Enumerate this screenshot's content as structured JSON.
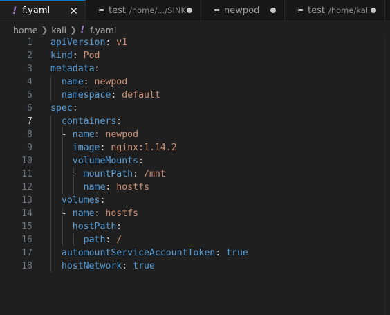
{
  "tabs": [
    {
      "label": "f.yaml",
      "icon": "yaml-exclamation-icon",
      "path": "",
      "active": true,
      "state": "close"
    },
    {
      "label": "test",
      "icon": "file-lines-icon",
      "path": "/home/.../SINK",
      "active": false,
      "state": "dirty"
    },
    {
      "label": "newpod",
      "icon": "file-lines-icon",
      "path": "",
      "active": false,
      "state": "dirty"
    },
    {
      "label": "test",
      "icon": "file-lines-icon",
      "path": "/home/kali",
      "active": false,
      "state": "dirty"
    }
  ],
  "breadcrumb": {
    "items": [
      "home",
      "kali",
      "f.yaml"
    ],
    "file_icon": "yaml-exclamation-icon"
  },
  "editor": {
    "current_line": 7,
    "lines": [
      {
        "n": "1",
        "indent": "",
        "key": "apiVersion",
        "colon": ":",
        "value": " v1",
        "vtype": "s"
      },
      {
        "n": "2",
        "indent": "",
        "key": "kind",
        "colon": ":",
        "value": " Pod",
        "vtype": "s"
      },
      {
        "n": "3",
        "indent": "",
        "key": "metadata",
        "colon": ":",
        "value": "",
        "vtype": "s"
      },
      {
        "n": "4",
        "indent": "  ",
        "key": "name",
        "colon": ":",
        "value": " newpod",
        "vtype": "s"
      },
      {
        "n": "5",
        "indent": "  ",
        "key": "namespace",
        "colon": ":",
        "value": " default",
        "vtype": "s"
      },
      {
        "n": "6",
        "indent": "",
        "key": "spec",
        "colon": ":",
        "value": "",
        "vtype": "s"
      },
      {
        "n": "7",
        "indent": "  ",
        "key": "containers",
        "colon": ":",
        "value": "",
        "vtype": "s"
      },
      {
        "n": "8",
        "indent": "  - ",
        "key": "name",
        "colon": ":",
        "value": " newpod",
        "vtype": "s"
      },
      {
        "n": "9",
        "indent": "    ",
        "key": "image",
        "colon": ":",
        "value": " nginx:1.14.2",
        "vtype": "s"
      },
      {
        "n": "10",
        "indent": "    ",
        "key": "volumeMounts",
        "colon": ":",
        "value": "",
        "vtype": "s"
      },
      {
        "n": "11",
        "indent": "    - ",
        "key": "mountPath",
        "colon": ":",
        "value": " /mnt",
        "vtype": "s"
      },
      {
        "n": "12",
        "indent": "      ",
        "key": "name",
        "colon": ":",
        "value": " hostfs",
        "vtype": "s"
      },
      {
        "n": "13",
        "indent": "  ",
        "key": "volumes",
        "colon": ":",
        "value": "",
        "vtype": "s"
      },
      {
        "n": "14",
        "indent": "  - ",
        "key": "name",
        "colon": ":",
        "value": " hostfs",
        "vtype": "s"
      },
      {
        "n": "15",
        "indent": "    ",
        "key": "hostPath",
        "colon": ":",
        "value": "",
        "vtype": "s"
      },
      {
        "n": "16",
        "indent": "      ",
        "key": "path",
        "colon": ":",
        "value": " /",
        "vtype": "s"
      },
      {
        "n": "17",
        "indent": "  ",
        "key": "automountServiceAccountToken",
        "colon": ":",
        "value": " true",
        "vtype": "b"
      },
      {
        "n": "18",
        "indent": "  ",
        "key": "hostNetwork",
        "colon": ":",
        "value": " true",
        "vtype": "b"
      }
    ]
  },
  "colors": {
    "background": "#1f1f1f",
    "tabbar": "#181818",
    "key": "#569cd6",
    "string": "#ce9178",
    "yaml_icon": "#a074c4",
    "line_number": "#6e7681"
  }
}
